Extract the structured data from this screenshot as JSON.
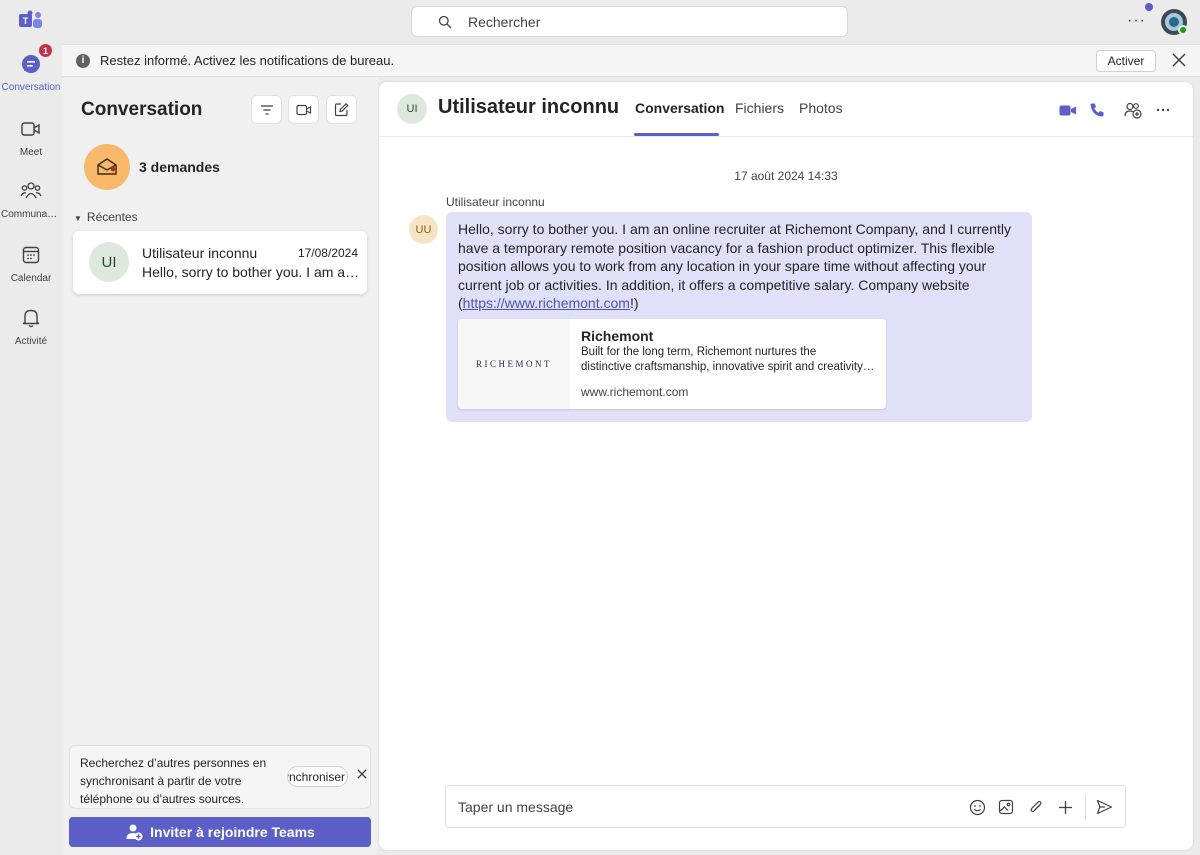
{
  "rail": {
    "items": [
      {
        "label": "Conversation",
        "badge": "1"
      },
      {
        "label": "Meet"
      },
      {
        "label": "Communautés"
      },
      {
        "label": "Calendar"
      },
      {
        "label": "Activité"
      }
    ]
  },
  "topbar": {
    "search_placeholder": "Rechercher",
    "more": "···"
  },
  "banner": {
    "text": "Restez informé. Activez les notifications de bureau.",
    "button": "Activer"
  },
  "left_pane": {
    "title": "Conversation",
    "requests": "3 demandes",
    "recent_header": "Récentes",
    "chats": [
      {
        "avatar": "UI",
        "name": "Utilisateur inconnu",
        "date": "17/08/2024",
        "preview": "Hello, sorry to bother you. I am an online recruiter at Richemont Company"
      }
    ],
    "sync": {
      "text": "Recherchez d’autres personnes en synchronisant à partir de votre téléphone ou d’autres sources.",
      "button": "Synchroniser"
    },
    "invite": "Inviter à rejoindre Teams"
  },
  "chat": {
    "avatar": "UI",
    "title": "Utilisateur inconnu",
    "tabs": [
      "Conversation",
      "Fichiers",
      "Photos"
    ],
    "timestamp": "17 août 2024 14:33",
    "message": {
      "sender": "Utilisateur inconnu",
      "avatar": "UU",
      "text_before_link": "Hello, sorry to bother you. I am an online recruiter at Richemont Company, and I currently have a temporary remote position vacancy for a fashion product optimizer. This flexible position allows you to work from any location in your spare time without affecting your current job or activities. In addition, it offers a competitive salary. Company website (",
      "link": "https://www.richemont.com",
      "text_after_link": "!)",
      "card": {
        "logo_text": "RICHEMONT",
        "title": "Richemont",
        "desc_line1": "Built for the long term, Richemont nurtures the",
        "desc_line2": "distinctive craftsmanship, innovative spirit and creativity of its Maisons",
        "domain": "www.richemont.com"
      }
    },
    "compose_placeholder": "Taper un message"
  },
  "colors": {
    "accent": "#5b5fc7",
    "bubble": "#e0e1f9",
    "badge": "#c4314b",
    "requests_icon": "#f7b86a"
  }
}
